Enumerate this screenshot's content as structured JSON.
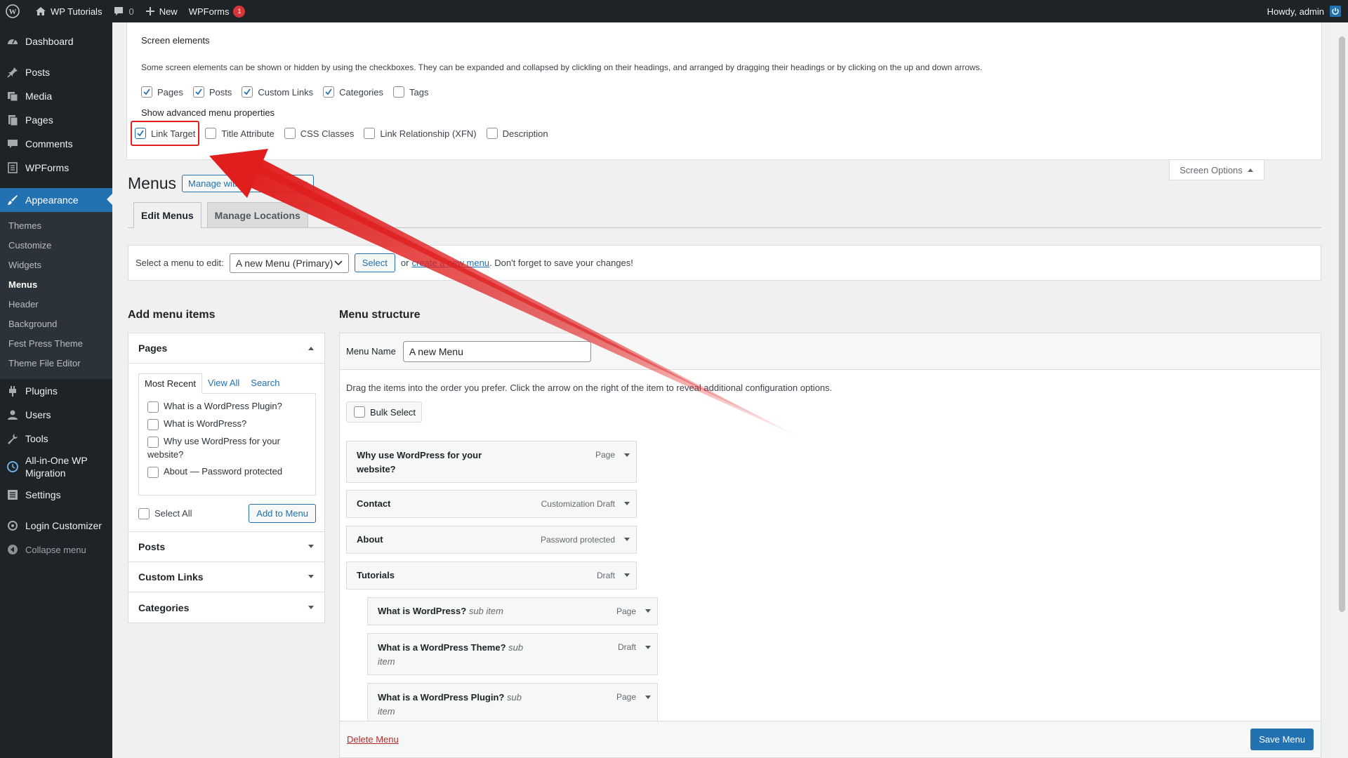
{
  "adminbar": {
    "site_name": "WP Tutorials",
    "comments_count": "0",
    "new_label": "New",
    "wpforms_label": "WPForms",
    "wpforms_badge": "1",
    "howdy": "Howdy, admin"
  },
  "sidebar": {
    "items": [
      {
        "label": "Dashboard",
        "icon": "dashboard-icon"
      },
      {
        "label": "Posts",
        "icon": "pin-icon"
      },
      {
        "label": "Media",
        "icon": "media-icon"
      },
      {
        "label": "Pages",
        "icon": "page-icon"
      },
      {
        "label": "Comments",
        "icon": "comment-icon"
      },
      {
        "label": "WPForms",
        "icon": "forms-icon"
      },
      {
        "label": "Appearance",
        "icon": "brush-icon"
      }
    ],
    "appearance_sub": [
      "Themes",
      "Customize",
      "Widgets",
      "Menus",
      "Header",
      "Background",
      "Fest Press Theme",
      "Theme File Editor"
    ],
    "lower_items": [
      {
        "label": "Plugins",
        "icon": "plugin-icon"
      },
      {
        "label": "Users",
        "icon": "users-icon"
      },
      {
        "label": "Tools",
        "icon": "tools-icon"
      },
      {
        "label": "All-in-One WP Migration",
        "icon": "migration-icon"
      },
      {
        "label": "Settings",
        "icon": "settings-icon"
      },
      {
        "label": "Login Customizer",
        "icon": "login-customizer-icon"
      },
      {
        "label": "Collapse menu",
        "icon": "collapse-icon"
      }
    ]
  },
  "screen_options": {
    "title": "Screen elements",
    "description": "Some screen elements can be shown or hidden by using the checkboxes. They can be expanded and collapsed by clickling on their headings, and arranged by dragging their headings or by clicking on the up and down arrows.",
    "elements": [
      {
        "label": "Pages",
        "checked": true
      },
      {
        "label": "Posts",
        "checked": true
      },
      {
        "label": "Custom Links",
        "checked": true
      },
      {
        "label": "Categories",
        "checked": true
      },
      {
        "label": "Tags",
        "checked": false
      }
    ],
    "advanced_title": "Show advanced menu properties",
    "advanced": [
      {
        "label": "Link Target",
        "checked": true
      },
      {
        "label": "Title Attribute",
        "checked": false
      },
      {
        "label": "CSS Classes",
        "checked": false
      },
      {
        "label": "Link Relationship (XFN)",
        "checked": false
      },
      {
        "label": "Description",
        "checked": false
      }
    ],
    "tab_label": "Screen Options"
  },
  "page": {
    "title": "Menus",
    "manage_btn_part1": "Manage with",
    "manage_btn_part2": "view",
    "tabs": [
      "Edit Menus",
      "Manage Locations"
    ]
  },
  "manage_menus": {
    "label": "Select a menu to edit:",
    "selected": "A new Menu (Primary)",
    "select_btn": "Select",
    "or_text": "or",
    "create_link_part1": "create a",
    "create_link_part2": "new menu",
    "after_text": ". Don't forget to save your changes!"
  },
  "add_items": {
    "title": "Add menu items",
    "pages_title": "Pages",
    "tabs": [
      "Most Recent",
      "View All",
      "Search"
    ],
    "recent": [
      "What is a WordPress Plugin?",
      "What is WordPress?",
      "Why use WordPress for your",
      "website?",
      "About",
      " — Password protected"
    ],
    "select_all": "Select All",
    "add_btn": "Add to Menu",
    "sections": [
      "Posts",
      "Custom Links",
      "Categories"
    ]
  },
  "structure": {
    "title": "Menu structure",
    "name_label": "Menu Name",
    "name_value": "A new Menu",
    "instructions": "Drag the items into the order you prefer. Click the arrow on the right of the item to reveal additional configuration options.",
    "bulk_select": "Bulk Select",
    "items": [
      {
        "title": "Why use WordPress for your website?",
        "sub": "",
        "type": "Page"
      },
      {
        "title": "Contact",
        "sub": "",
        "type": "Customization Draft"
      },
      {
        "title": "About",
        "sub": "",
        "type": "Password protected"
      },
      {
        "title": "Tutorials",
        "sub": "",
        "type": "Draft"
      },
      {
        "title": "What is WordPress?",
        "sub": "sub item",
        "type": "Page"
      },
      {
        "title": "What is a WordPress Theme?",
        "sub": "sub item",
        "type": "Draft"
      },
      {
        "title": "What is a WordPress Plugin?",
        "sub": "sub item",
        "type": "Page"
      }
    ],
    "delete_link": "Delete Menu",
    "save_btn": "Save Menu"
  },
  "colors": {
    "accent": "#2271b1",
    "highlight": "#e01e1e",
    "sidebar": "#1d2327"
  }
}
